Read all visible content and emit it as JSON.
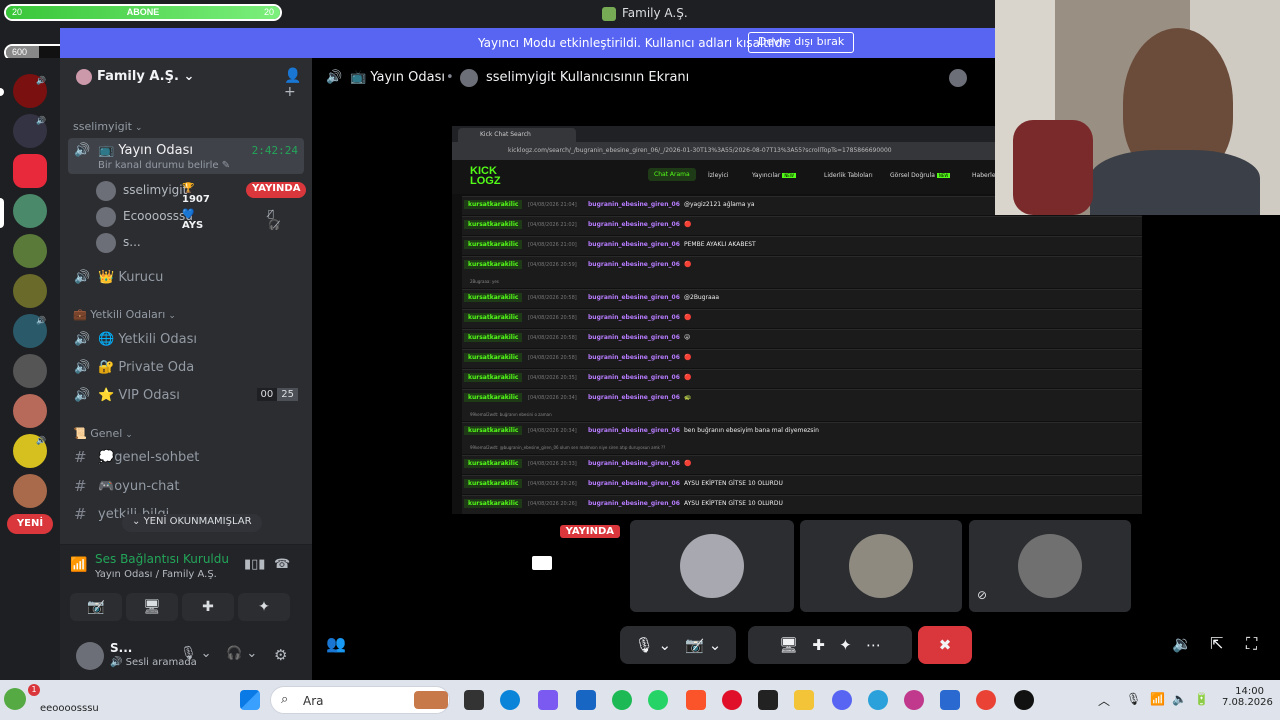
{
  "window": {
    "title": "Family A.Ş."
  },
  "overlay": {
    "abone": {
      "label": "ABONE",
      "left": "20",
      "right": "20",
      "progress": 1.0
    },
    "kicks": {
      "label": "KICKS",
      "left": "600",
      "right": "5000",
      "progress": 0.12
    }
  },
  "banner": {
    "text": "Yayıncı Modu etkinleştirildi. Kullanıcı adları kısaltıldı.",
    "button": "Devre dışı bırak"
  },
  "rail": {
    "new_label": "YENİ"
  },
  "guild": {
    "name": "Family A.Ş."
  },
  "sidebar": {
    "category_user": "sselimyigit",
    "active_channel": {
      "name": "Yayın Odası",
      "time": "2:42:24",
      "status_placeholder": "Bir kanal durumu belirle"
    },
    "voice_users": [
      {
        "name": "sselimyigit",
        "trophy": "1907",
        "live": "YAYINDA"
      },
      {
        "name": "Ecoooosssu",
        "tag": "AYS"
      },
      {
        "name": "s..."
      }
    ],
    "channel_kurucu": "Kurucu",
    "category_yetkili": "Yetkili Odaları",
    "yetkili_channels": [
      {
        "emoji": "🌐",
        "name": "Yetkili Odası"
      },
      {
        "emoji": "🔐",
        "name": "Private Oda"
      },
      {
        "emoji": "⭐",
        "name": "VIP Odası",
        "count_a": "00",
        "count_b": "25"
      }
    ],
    "category_genel": "Genel",
    "text_channels": [
      {
        "emoji": "💭",
        "name": "genel-sohbet"
      },
      {
        "emoji": "🎮",
        "name": "oyun-chat"
      },
      {
        "emoji": "",
        "name": "yetkili-bilgi"
      }
    ],
    "unread_label": "YENİ OKUNMAMIŞLAR"
  },
  "voice_panel": {
    "title": "Ses Bağlantısı Kuruldu",
    "subtitle": "Yayın Odası / Family A.Ş."
  },
  "user_panel": {
    "name": "S...",
    "status": "Sesli aramada"
  },
  "stage": {
    "channel": "Yayın Odası",
    "screen_title": "sselimyigit Kullanıcısının Ekranı",
    "tile_live": "YAYINDA"
  },
  "share": {
    "tab_title": "Kick Chat Search",
    "url": "kicklogz.com/search/_/bugranin_ebesine_giren_06/_/2026-01-30T13%3A55/2026-08-07T13%3A55?scrollTopTs=1785866690000",
    "logo_top": "KICK",
    "logo_bottom": "LOGZ",
    "nav": [
      "Chat Arama",
      "İzleyici",
      "Yayıncılar",
      "Liderlik Tabloları",
      "Görsel Doğrula",
      "Haberle"
    ],
    "new_tag": "NEW",
    "messages": [
      {
        "user": "kursatkarakilic",
        "ts": "[04/08/2026 21:04]",
        "to": "bugranin_ebesine_giren_06",
        "text": "@yagiz2121 ağlama ya"
      },
      {
        "user": "kursatkarakilic",
        "ts": "[04/08/2026 21:02]",
        "to": "bugranin_ebesine_giren_06",
        "text": "🔴"
      },
      {
        "user": "kursatkarakilic",
        "ts": "[04/08/2026 21:00]",
        "to": "bugranin_ebesine_giren_06",
        "text": "PEMBE AYAKLI AKABEST"
      },
      {
        "user": "kursatkarakilic",
        "ts": "[04/08/2026 20:59]",
        "to": "bugranin_ebesine_giren_06",
        "text": "🔴",
        "reply": "2Bugraaa: yes"
      },
      {
        "user": "kursatkarakilic",
        "ts": "[04/08/2026 20:58]",
        "to": "bugranin_ebesine_giren_06",
        "text": "@2Bugraaa"
      },
      {
        "user": "kursatkarakilic",
        "ts": "[04/08/2026 20:58]",
        "to": "bugranin_ebesine_giren_06",
        "text": "🔴"
      },
      {
        "user": "kursatkarakilic",
        "ts": "[04/08/2026 20:58]",
        "to": "bugranin_ebesine_giren_06",
        "text": "😜"
      },
      {
        "user": "kursatkarakilic",
        "ts": "[04/08/2026 20:58]",
        "to": "bugranin_ebesine_giren_06",
        "text": "🔴"
      },
      {
        "user": "kursatkarakilic",
        "ts": "[04/08/2026 20:35]",
        "to": "bugranin_ebesine_giren_06",
        "text": "🔴"
      },
      {
        "user": "kursatkarakilic",
        "ts": "[04/08/2026 20:34]",
        "to": "bugranin_ebesine_giren_06",
        "text": "🐢",
        "reply": "99kemal2wdt: buğranın ebesini o zaman"
      },
      {
        "user": "kursatkarakilic",
        "ts": "[04/08/2026 20:34]",
        "to": "bugranin_ebesine_giren_06",
        "text": "ben buğranın ebesiyim bana mal diyemezsin",
        "reply": "99kemal2wdt: @bugranin_ebesine_giren_06 olum sen malmısın niye siren atıp duruyosun amk ??"
      },
      {
        "user": "kursatkarakilic",
        "ts": "[04/08/2026 20:33]",
        "to": "bugranin_ebesine_giren_06",
        "text": "🔴"
      },
      {
        "user": "kursatkarakilic",
        "ts": "[04/08/2026 20:26]",
        "to": "bugranin_ebesine_giren_06",
        "text": "AYSU EKİPTEN GİTSE 10 OLURDU"
      },
      {
        "user": "kursatkarakilic",
        "ts": "[04/08/2026 20:26]",
        "to": "bugranin_ebesine_giren_06",
        "text": "AYSU EKİPTEN GİTSE 10 OLURDU"
      }
    ]
  },
  "taskbar": {
    "search_placeholder": "Ara",
    "time": "14:00",
    "date": "7.08.2026",
    "notif_count": "1",
    "user_tag": "eeoooosssu"
  },
  "colors": {
    "accent": "#5865f2",
    "live": "#da373c",
    "online": "#23a559",
    "kick_green": "#53fc18",
    "kick_purple": "#b77cff"
  }
}
